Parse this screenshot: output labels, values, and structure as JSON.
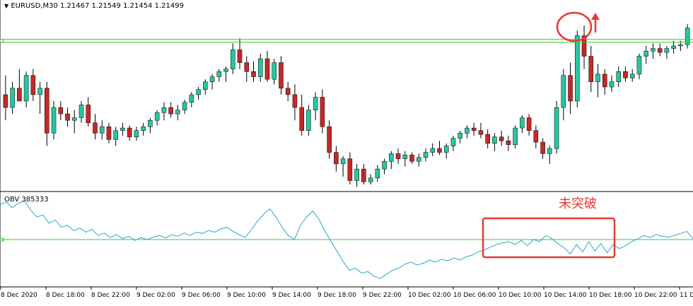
{
  "window": {
    "symbol_line": "EURUSD,M30  1.21467 1.21549 1.21454 1.21499",
    "indicator_line": "OBV 385333"
  },
  "annotation": {
    "note": "未突破"
  },
  "colors": {
    "bull": "#26c6a0",
    "bear": "#c62828",
    "wick": "#000000",
    "level_line": "#33cc33",
    "obv_line": "#2aa7c9",
    "annotation": "#e53935",
    "axis": "#000000",
    "background": "#ffffff"
  },
  "chart_data": [
    {
      "type": "candlestick",
      "title": "EURUSD,M30",
      "ohlc_readout": "1.21467 1.21549 1.21454 1.21499",
      "x_tick_labels": [
        "8 Dec 2020",
        "8 Dec 18:00",
        "8 Dec 22:00",
        "9 Dec 02:00",
        "9 Dec 06:00",
        "9 Dec 10:00",
        "9 Dec 14:00",
        "9 Dec 18:00",
        "9 Dec 22:00",
        "10 Dec 02:00",
        "10 Dec 06:00",
        "10 Dec 10:00",
        "10 Dec 14:00",
        "10 Dec 18:00",
        "10 Dec 22:00",
        "11 D"
      ],
      "horizontal_level": 1.2172,
      "ylim": [
        1.2055,
        1.2195
      ],
      "candles": [
        [
          1.213,
          1.2145,
          1.211,
          1.212
        ],
        [
          1.212,
          1.214,
          1.2115,
          1.2135
        ],
        [
          1.2135,
          1.215,
          1.2125,
          1.2125
        ],
        [
          1.2125,
          1.2148,
          1.212,
          1.2145
        ],
        [
          1.2145,
          1.215,
          1.2125,
          1.213
        ],
        [
          1.213,
          1.214,
          1.2115,
          1.2135
        ],
        [
          1.2135,
          1.214,
          1.209,
          1.21
        ],
        [
          1.21,
          1.2125,
          1.2095,
          1.212
        ],
        [
          1.212,
          1.2125,
          1.211,
          1.2115
        ],
        [
          1.2115,
          1.212,
          1.2105,
          1.211
        ],
        [
          1.211,
          1.2118,
          1.21,
          1.2112
        ],
        [
          1.2112,
          1.2125,
          1.2108,
          1.2122
        ],
        [
          1.2122,
          1.2128,
          1.2105,
          1.2108
        ],
        [
          1.2108,
          1.2115,
          1.2095,
          1.21
        ],
        [
          1.21,
          1.211,
          1.2095,
          1.2105
        ],
        [
          1.2105,
          1.2108,
          1.2092,
          1.2095
        ],
        [
          1.2095,
          1.2105,
          1.209,
          1.2102
        ],
        [
          1.2102,
          1.2108,
          1.2098,
          1.2104
        ],
        [
          1.2104,
          1.2106,
          1.2094,
          1.2097
        ],
        [
          1.2097,
          1.2105,
          1.2094,
          1.2102
        ],
        [
          1.2102,
          1.2108,
          1.2098,
          1.2105
        ],
        [
          1.2105,
          1.2112,
          1.21,
          1.211
        ],
        [
          1.211,
          1.2118,
          1.2106,
          1.2116
        ],
        [
          1.2116,
          1.2124,
          1.211,
          1.212
        ],
        [
          1.212,
          1.2124,
          1.2112,
          1.2115
        ],
        [
          1.2115,
          1.2122,
          1.211,
          1.2118
        ],
        [
          1.2118,
          1.2126,
          1.2115,
          1.2124
        ],
        [
          1.2124,
          1.2132,
          1.212,
          1.213
        ],
        [
          1.213,
          1.2136,
          1.2126,
          1.2134
        ],
        [
          1.2134,
          1.2142,
          1.213,
          1.214
        ],
        [
          1.214,
          1.2146,
          1.2134,
          1.2144
        ],
        [
          1.2144,
          1.215,
          1.214,
          1.2148
        ],
        [
          1.2148,
          1.2152,
          1.214,
          1.215
        ],
        [
          1.215,
          1.217,
          1.2146,
          1.2165
        ],
        [
          1.2165,
          1.2174,
          1.215,
          1.2155
        ],
        [
          1.2155,
          1.216,
          1.214,
          1.2148
        ],
        [
          1.2148,
          1.2156,
          1.214,
          1.2144
        ],
        [
          1.2144,
          1.2162,
          1.214,
          1.2158
        ],
        [
          1.2158,
          1.2164,
          1.214,
          1.2142
        ],
        [
          1.2142,
          1.2158,
          1.2138,
          1.2155
        ],
        [
          1.2155,
          1.216,
          1.213,
          1.2135
        ],
        [
          1.2135,
          1.214,
          1.2125,
          1.213
        ],
        [
          1.213,
          1.2138,
          1.211,
          1.212
        ],
        [
          1.212,
          1.213,
          1.2098,
          1.2102
        ],
        [
          1.2102,
          1.2122,
          1.2098,
          1.2118
        ],
        [
          1.2118,
          1.2132,
          1.211,
          1.2128
        ],
        [
          1.2128,
          1.2134,
          1.21,
          1.2105
        ],
        [
          1.2105,
          1.211,
          1.208,
          1.2085
        ],
        [
          1.2085,
          1.209,
          1.207,
          1.2076
        ],
        [
          1.2076,
          1.2082,
          1.2066,
          1.208
        ],
        [
          1.208,
          1.2085,
          1.206,
          1.2063
        ],
        [
          1.2063,
          1.2076,
          1.2058,
          1.2072
        ],
        [
          1.2072,
          1.2076,
          1.206,
          1.2062
        ],
        [
          1.2062,
          1.2068,
          1.206,
          1.2065
        ],
        [
          1.2065,
          1.2075,
          1.2062,
          1.2072
        ],
        [
          1.2072,
          1.208,
          1.2068,
          1.2078
        ],
        [
          1.2078,
          1.2086,
          1.2072,
          1.2084
        ],
        [
          1.2084,
          1.2088,
          1.2076,
          1.208
        ],
        [
          1.208,
          1.2086,
          1.2074,
          1.2083
        ],
        [
          1.2083,
          1.2085,
          1.2076,
          1.2078
        ],
        [
          1.2078,
          1.2084,
          1.2074,
          1.2081
        ],
        [
          1.2081,
          1.2088,
          1.2078,
          1.2085
        ],
        [
          1.2085,
          1.2092,
          1.2082,
          1.2088
        ],
        [
          1.2088,
          1.2094,
          1.2083,
          1.2085
        ],
        [
          1.2085,
          1.2092,
          1.208,
          1.209
        ],
        [
          1.209,
          1.2098,
          1.2086,
          1.2096
        ],
        [
          1.2096,
          1.2102,
          1.2092,
          1.21
        ],
        [
          1.21,
          1.2106,
          1.2096,
          1.2104
        ],
        [
          1.2104,
          1.2108,
          1.2098,
          1.2102
        ],
        [
          1.2102,
          1.2108,
          1.2096,
          1.2099
        ],
        [
          1.2099,
          1.2103,
          1.2088,
          1.2092
        ],
        [
          1.2092,
          1.21,
          1.2086,
          1.2097
        ],
        [
          1.2097,
          1.2102,
          1.209,
          1.2094
        ],
        [
          1.2094,
          1.2098,
          1.2086,
          1.2091
        ],
        [
          1.2091,
          1.2106,
          1.2088,
          1.2104
        ],
        [
          1.2104,
          1.2114,
          1.21,
          1.2112
        ],
        [
          1.2112,
          1.2115,
          1.2098,
          1.2102
        ],
        [
          1.2102,
          1.2106,
          1.2088,
          1.2093
        ],
        [
          1.2093,
          1.2096,
          1.208,
          1.2084
        ],
        [
          1.2084,
          1.209,
          1.2076,
          1.2088
        ],
        [
          1.2088,
          1.2125,
          1.2084,
          1.212
        ],
        [
          1.212,
          1.215,
          1.211,
          1.2145
        ],
        [
          1.2145,
          1.2155,
          1.2115,
          1.2125
        ],
        [
          1.2125,
          1.218,
          1.212,
          1.2176
        ],
        [
          1.2176,
          1.2184,
          1.215,
          1.216
        ],
        [
          1.216,
          1.2168,
          1.2132,
          1.214
        ],
        [
          1.214,
          1.2154,
          1.2128,
          1.2146
        ],
        [
          1.2146,
          1.215,
          1.213,
          1.2136
        ],
        [
          1.2136,
          1.2145,
          1.2132,
          1.214
        ],
        [
          1.214,
          1.2152,
          1.2136,
          1.2148
        ],
        [
          1.2148,
          1.2152,
          1.214,
          1.2143
        ],
        [
          1.2143,
          1.215,
          1.214,
          1.2146
        ],
        [
          1.2146,
          1.2162,
          1.2142,
          1.216
        ],
        [
          1.216,
          1.2168,
          1.2154,
          1.2164
        ],
        [
          1.2164,
          1.217,
          1.2158,
          1.2166
        ],
        [
          1.2166,
          1.217,
          1.216,
          1.2163
        ],
        [
          1.2163,
          1.2168,
          1.2158,
          1.2166
        ],
        [
          1.2166,
          1.2172,
          1.2162,
          1.2168
        ],
        [
          1.2168,
          1.2172,
          1.2164,
          1.2169
        ],
        [
          1.2169,
          1.2185,
          1.2166,
          1.2182
        ]
      ]
    },
    {
      "type": "line",
      "title": "OBV 385333",
      "horizontal_level": 0.0,
      "ylim": [
        -1.0,
        1.0
      ],
      "values": [
        0.85,
        0.92,
        0.78,
        0.88,
        0.95,
        0.72,
        0.55,
        0.6,
        0.4,
        0.48,
        0.3,
        0.35,
        0.22,
        0.28,
        0.18,
        0.25,
        0.1,
        0.16,
        0.05,
        0.12,
        0.02,
        0.08,
        -0.02,
        0.05,
        0.0,
        0.06,
        0.1,
        0.04,
        0.12,
        0.08,
        0.16,
        0.1,
        0.18,
        0.15,
        0.22,
        0.18,
        0.26,
        0.3,
        0.2,
        0.12,
        0.05,
        0.25,
        0.45,
        0.62,
        0.75,
        0.55,
        0.3,
        0.1,
        0.0,
        0.35,
        0.55,
        0.7,
        0.5,
        0.2,
        -0.05,
        -0.3,
        -0.55,
        -0.75,
        -0.7,
        -0.82,
        -0.78,
        -0.9,
        -0.95,
        -0.85,
        -0.75,
        -0.7,
        -0.6,
        -0.55,
        -0.62,
        -0.58,
        -0.5,
        -0.55,
        -0.48,
        -0.52,
        -0.45,
        -0.5,
        -0.42,
        -0.38,
        -0.3,
        -0.25,
        -0.18,
        -0.12,
        -0.08,
        -0.05,
        -0.12,
        -0.02,
        -0.15,
        0.0,
        -0.05,
        0.1,
        0.02,
        -0.1,
        -0.2,
        -0.35,
        -0.12,
        -0.3,
        -0.05,
        -0.28,
        -0.1,
        -0.32,
        -0.12,
        -0.22,
        -0.15,
        -0.05,
        0.02,
        0.1,
        0.05,
        0.12,
        0.08,
        0.06,
        0.1,
        0.15,
        0.2,
        0.02
      ]
    }
  ]
}
